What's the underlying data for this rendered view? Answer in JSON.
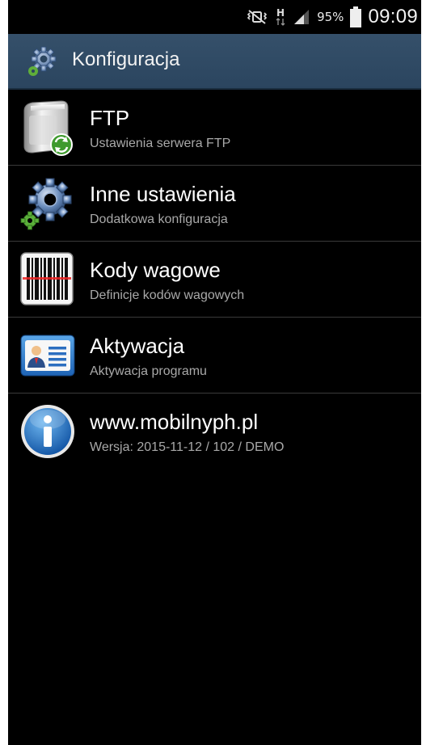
{
  "status_bar": {
    "battery_percent": "95%",
    "time": "09:09",
    "icons": [
      "mute-vibrate-icon",
      "hspa-data-icon",
      "signal-icon",
      "battery-icon"
    ]
  },
  "action_bar": {
    "title": "Konfiguracja",
    "icon": "gear-icon"
  },
  "menu": {
    "items": [
      {
        "title": "FTP",
        "subtitle": "Ustawienia serwera FTP",
        "icon": "ftp-server-icon"
      },
      {
        "title": "Inne ustawienia",
        "subtitle": "Dodatkowa konfiguracja",
        "icon": "gear-icon"
      },
      {
        "title": "Kody wagowe",
        "subtitle": "Definicje kodów wagowych",
        "icon": "barcode-icon"
      },
      {
        "title": "Aktywacja",
        "subtitle": "Aktywacja programu",
        "icon": "id-card-icon"
      },
      {
        "title": "www.mobilnyph.pl",
        "subtitle": "Wersja: 2015-11-12 / 102 / DEMO",
        "icon": "info-icon"
      }
    ]
  },
  "colors": {
    "action_bar": "#2f4a63",
    "background": "#000000",
    "subtitle": "#a9a9a9"
  }
}
